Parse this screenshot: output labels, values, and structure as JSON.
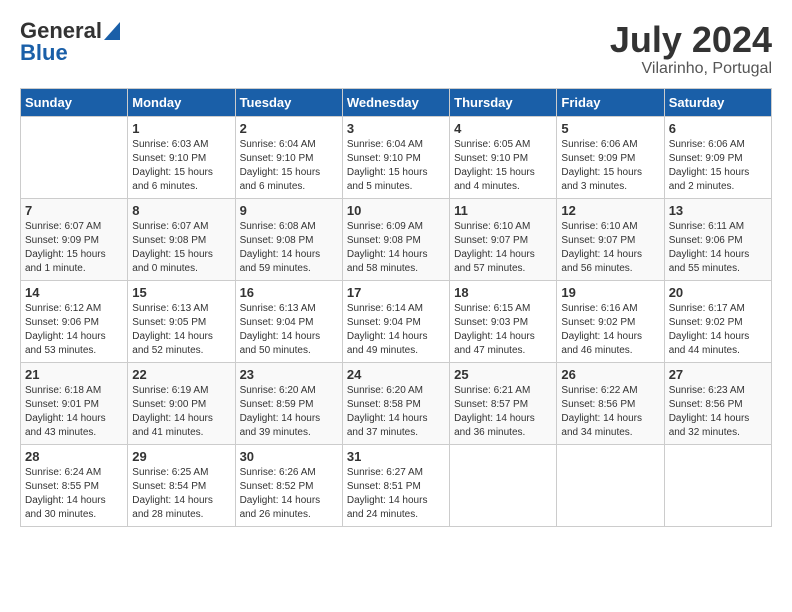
{
  "header": {
    "logo_general": "General",
    "logo_blue": "Blue",
    "month": "July 2024",
    "location": "Vilarinho, Portugal"
  },
  "days_of_week": [
    "Sunday",
    "Monday",
    "Tuesday",
    "Wednesday",
    "Thursday",
    "Friday",
    "Saturday"
  ],
  "weeks": [
    [
      {
        "day": "",
        "info": ""
      },
      {
        "day": "1",
        "info": "Sunrise: 6:03 AM\nSunset: 9:10 PM\nDaylight: 15 hours\nand 6 minutes."
      },
      {
        "day": "2",
        "info": "Sunrise: 6:04 AM\nSunset: 9:10 PM\nDaylight: 15 hours\nand 6 minutes."
      },
      {
        "day": "3",
        "info": "Sunrise: 6:04 AM\nSunset: 9:10 PM\nDaylight: 15 hours\nand 5 minutes."
      },
      {
        "day": "4",
        "info": "Sunrise: 6:05 AM\nSunset: 9:10 PM\nDaylight: 15 hours\nand 4 minutes."
      },
      {
        "day": "5",
        "info": "Sunrise: 6:06 AM\nSunset: 9:09 PM\nDaylight: 15 hours\nand 3 minutes."
      },
      {
        "day": "6",
        "info": "Sunrise: 6:06 AM\nSunset: 9:09 PM\nDaylight: 15 hours\nand 2 minutes."
      }
    ],
    [
      {
        "day": "7",
        "info": "Sunrise: 6:07 AM\nSunset: 9:09 PM\nDaylight: 15 hours\nand 1 minute."
      },
      {
        "day": "8",
        "info": "Sunrise: 6:07 AM\nSunset: 9:08 PM\nDaylight: 15 hours\nand 0 minutes."
      },
      {
        "day": "9",
        "info": "Sunrise: 6:08 AM\nSunset: 9:08 PM\nDaylight: 14 hours\nand 59 minutes."
      },
      {
        "day": "10",
        "info": "Sunrise: 6:09 AM\nSunset: 9:08 PM\nDaylight: 14 hours\nand 58 minutes."
      },
      {
        "day": "11",
        "info": "Sunrise: 6:10 AM\nSunset: 9:07 PM\nDaylight: 14 hours\nand 57 minutes."
      },
      {
        "day": "12",
        "info": "Sunrise: 6:10 AM\nSunset: 9:07 PM\nDaylight: 14 hours\nand 56 minutes."
      },
      {
        "day": "13",
        "info": "Sunrise: 6:11 AM\nSunset: 9:06 PM\nDaylight: 14 hours\nand 55 minutes."
      }
    ],
    [
      {
        "day": "14",
        "info": "Sunrise: 6:12 AM\nSunset: 9:06 PM\nDaylight: 14 hours\nand 53 minutes."
      },
      {
        "day": "15",
        "info": "Sunrise: 6:13 AM\nSunset: 9:05 PM\nDaylight: 14 hours\nand 52 minutes."
      },
      {
        "day": "16",
        "info": "Sunrise: 6:13 AM\nSunset: 9:04 PM\nDaylight: 14 hours\nand 50 minutes."
      },
      {
        "day": "17",
        "info": "Sunrise: 6:14 AM\nSunset: 9:04 PM\nDaylight: 14 hours\nand 49 minutes."
      },
      {
        "day": "18",
        "info": "Sunrise: 6:15 AM\nSunset: 9:03 PM\nDaylight: 14 hours\nand 47 minutes."
      },
      {
        "day": "19",
        "info": "Sunrise: 6:16 AM\nSunset: 9:02 PM\nDaylight: 14 hours\nand 46 minutes."
      },
      {
        "day": "20",
        "info": "Sunrise: 6:17 AM\nSunset: 9:02 PM\nDaylight: 14 hours\nand 44 minutes."
      }
    ],
    [
      {
        "day": "21",
        "info": "Sunrise: 6:18 AM\nSunset: 9:01 PM\nDaylight: 14 hours\nand 43 minutes."
      },
      {
        "day": "22",
        "info": "Sunrise: 6:19 AM\nSunset: 9:00 PM\nDaylight: 14 hours\nand 41 minutes."
      },
      {
        "day": "23",
        "info": "Sunrise: 6:20 AM\nSunset: 8:59 PM\nDaylight: 14 hours\nand 39 minutes."
      },
      {
        "day": "24",
        "info": "Sunrise: 6:20 AM\nSunset: 8:58 PM\nDaylight: 14 hours\nand 37 minutes."
      },
      {
        "day": "25",
        "info": "Sunrise: 6:21 AM\nSunset: 8:57 PM\nDaylight: 14 hours\nand 36 minutes."
      },
      {
        "day": "26",
        "info": "Sunrise: 6:22 AM\nSunset: 8:56 PM\nDaylight: 14 hours\nand 34 minutes."
      },
      {
        "day": "27",
        "info": "Sunrise: 6:23 AM\nSunset: 8:56 PM\nDaylight: 14 hours\nand 32 minutes."
      }
    ],
    [
      {
        "day": "28",
        "info": "Sunrise: 6:24 AM\nSunset: 8:55 PM\nDaylight: 14 hours\nand 30 minutes."
      },
      {
        "day": "29",
        "info": "Sunrise: 6:25 AM\nSunset: 8:54 PM\nDaylight: 14 hours\nand 28 minutes."
      },
      {
        "day": "30",
        "info": "Sunrise: 6:26 AM\nSunset: 8:52 PM\nDaylight: 14 hours\nand 26 minutes."
      },
      {
        "day": "31",
        "info": "Sunrise: 6:27 AM\nSunset: 8:51 PM\nDaylight: 14 hours\nand 24 minutes."
      },
      {
        "day": "",
        "info": ""
      },
      {
        "day": "",
        "info": ""
      },
      {
        "day": "",
        "info": ""
      }
    ]
  ]
}
